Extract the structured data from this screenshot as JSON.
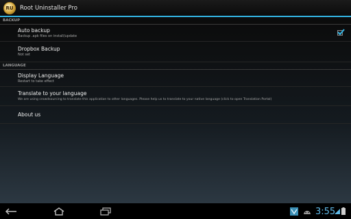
{
  "actionbar": {
    "icon_text": "RU",
    "title": "Root Uninstaller Pro"
  },
  "sections": {
    "backup": {
      "header": "BACKUP",
      "auto_backup": {
        "title": "Auto backup",
        "summary": "Backup .apk files on install/update",
        "checked": true
      },
      "dropbox": {
        "title": "Dropbox Backup",
        "summary": "Not set"
      }
    },
    "language": {
      "header": "LANGUAGE",
      "display_language": {
        "title": "Display Language",
        "summary": "Restart to take effect"
      },
      "translate": {
        "title": "Translate to your language",
        "summary": "We are using crowdsourcing to translate this application to other languages. Please help us to translate to your native language (click to open Translation Portal)"
      },
      "about": {
        "title": "About us"
      }
    }
  },
  "statusbar": {
    "time": "3:55"
  },
  "colors": {
    "accent": "#33b5e5",
    "clock": "#5fb8e6"
  },
  "icons": [
    "back-icon",
    "home-icon",
    "recent-apps-icon",
    "app-notification-icon",
    "android-robot-icon",
    "signal-icon",
    "battery-icon"
  ]
}
